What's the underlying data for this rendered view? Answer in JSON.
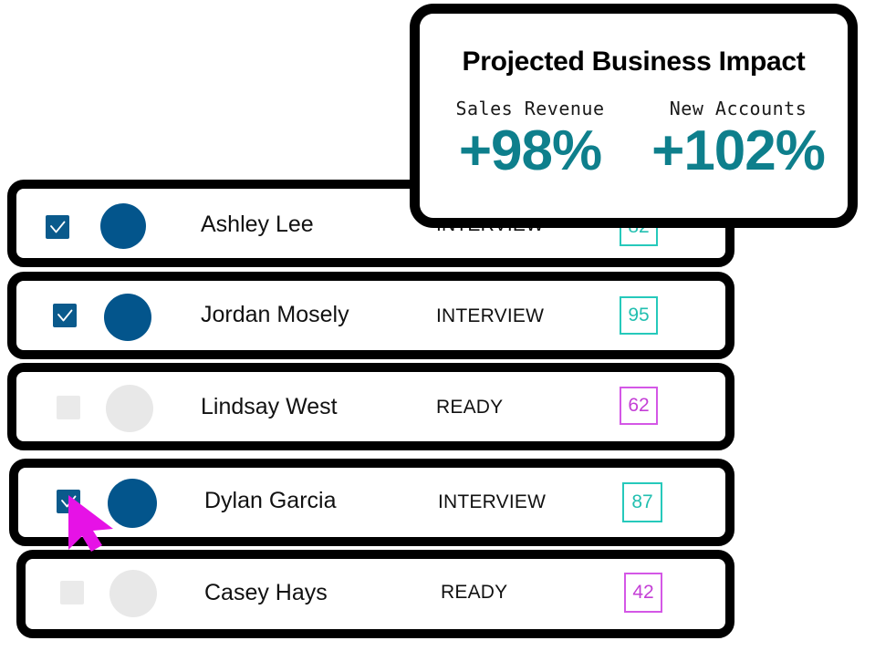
{
  "impact_card": {
    "title": "Projected Business Impact",
    "metrics": [
      {
        "label": "Sales Revenue",
        "value": "+98%"
      },
      {
        "label": "New Accounts",
        "value": "+102%"
      }
    ],
    "accent_color": "#0e7f8c"
  },
  "candidate_list": {
    "rows": [
      {
        "name": "Ashley Lee",
        "status": "INTERVIEW",
        "score": "82",
        "checked": true,
        "avatar": "filled"
      },
      {
        "name": "Jordan Mosely",
        "status": "INTERVIEW",
        "score": "95",
        "checked": true,
        "avatar": "filled"
      },
      {
        "name": "Lindsay West",
        "status": "READY",
        "score": "62",
        "checked": false,
        "avatar": "empty"
      },
      {
        "name": "Dylan Garcia",
        "status": "INTERVIEW",
        "score": "87",
        "checked": true,
        "avatar": "filled"
      },
      {
        "name": "Casey Hays",
        "status": "READY",
        "score": "42",
        "checked": false,
        "avatar": "empty"
      }
    ],
    "colors": {
      "interview_badge": "#26c9bb",
      "ready_badge": "#d457e6",
      "avatar_filled": "#03558c",
      "avatar_empty": "#e8e8e8",
      "checkbox_checked": "#0a5a8c",
      "checkbox_unchecked": "#eaeaea"
    }
  },
  "cursor": {
    "icon": "arrow-pointer",
    "color": "#e612e6"
  }
}
